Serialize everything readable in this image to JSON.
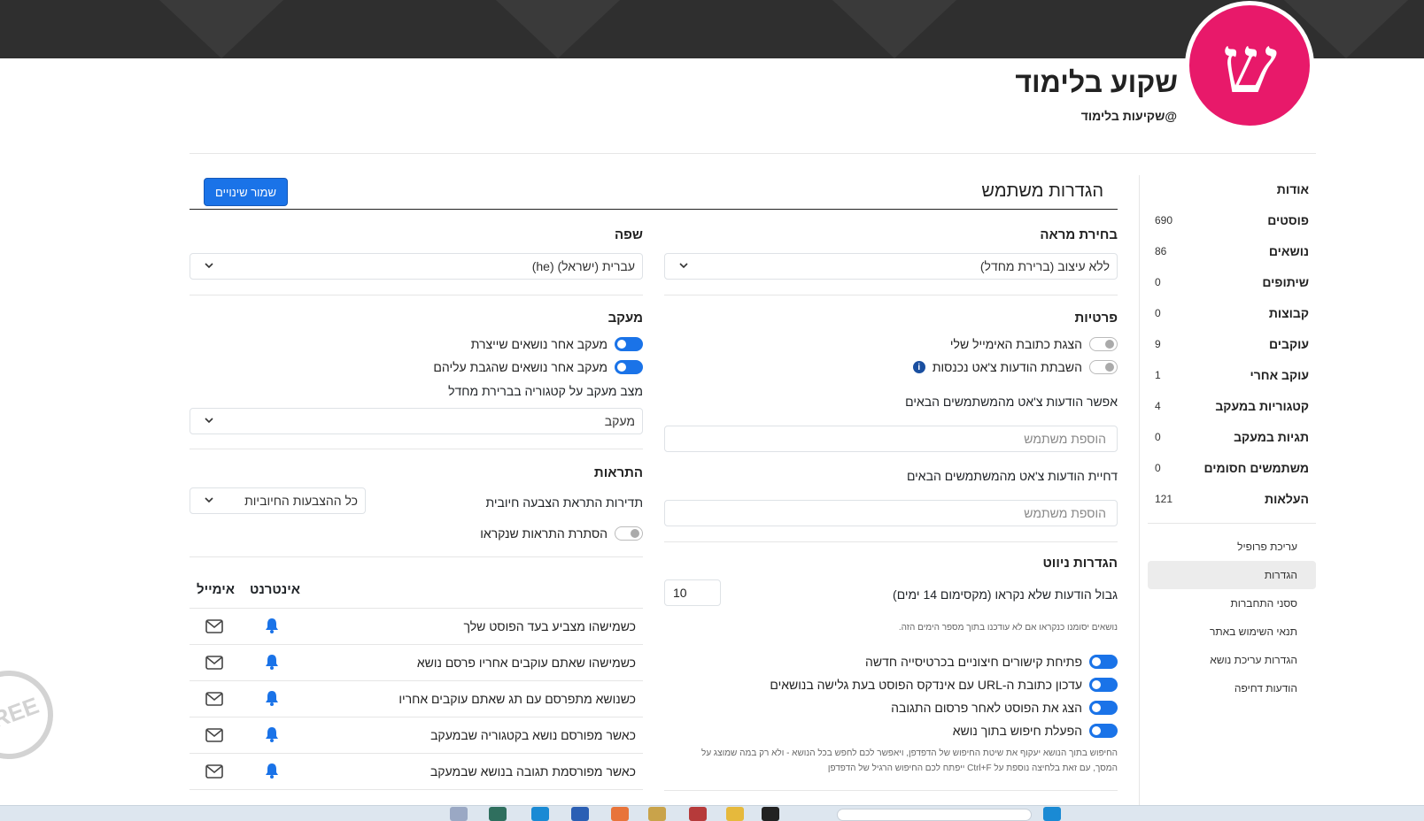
{
  "profile": {
    "initial": "ש",
    "name": "שקוע בלימוד",
    "handle": "@שקיעות בלימוד"
  },
  "sidebar": {
    "items": [
      {
        "label": "אודות",
        "count": ""
      },
      {
        "label": "פוסטים",
        "count": "690"
      },
      {
        "label": "נושאים",
        "count": "86"
      },
      {
        "label": "שיתופים",
        "count": "0"
      },
      {
        "label": "קבוצות",
        "count": "0"
      },
      {
        "label": "עוקבים",
        "count": "9"
      },
      {
        "label": "עוקב אחרי",
        "count": "1"
      },
      {
        "label": "קטגוריות במעקב",
        "count": "4"
      },
      {
        "label": "תגיות במעקב",
        "count": "0"
      },
      {
        "label": "משתמשים חסומים",
        "count": "0"
      },
      {
        "label": "העלאות",
        "count": "121"
      }
    ],
    "links": [
      "עריכת פרופיל",
      "הגדרות",
      "ססני התחברות",
      "תנאי השימוש באתר",
      "הגדרות עריכת נושא",
      "הודעות דחיפה"
    ],
    "active_link": "הגדרות"
  },
  "main": {
    "title": "הגדרות משתמש",
    "save_label": "שמור שינויים",
    "appearance": {
      "title": "בחירת מראה",
      "value": "ללא עיצוב (ברירת מחדל)"
    },
    "language": {
      "title": "שפה",
      "value": "עברית (ישראל) (he)"
    },
    "privacy": {
      "title": "פרטיות",
      "show_email": "הצגת כתובת האימייל שלי",
      "mute_chat": "השבתת הודעות צ'אט נכנסות",
      "allow_chat_label": "אפשר הודעות צ'אט מהמשתמשים הבאים",
      "allow_chat_placeholder": "הוספת משתמש",
      "deny_chat_label": "דחיית הודעות צ'אט מהמשתמשים הבאים",
      "deny_chat_placeholder": "הוספת משתמש"
    },
    "tracking": {
      "title": "מעקב",
      "follow_created": "מעקב אחר נושאים שייצרת",
      "follow_replied": "מעקב אחר נושאים שהגבת עליהם",
      "category_label": "מצב מעקב על קטגוריה בברירת מחדל",
      "category_value": "מעקב"
    },
    "notifications": {
      "title": "התראות",
      "upvote_freq_label": "תדירות התראת הצבעה חיובית",
      "upvote_freq_value": "כל ההצבעות החיוביות",
      "hide_read": "הסתרת התראות שנקראו",
      "col_web": "אינטרנט",
      "col_email": "אימייל",
      "rows": [
        "כשמישהו מצביע בעד הפוסט שלך",
        "כשמישהו שאתם עוקבים אחריו פרסם נושא",
        "כשנושא מתפרסם עם תג שאתם עוקבים אחריו",
        "כאשר מפורסם נושא בקטגוריה שבמעקב",
        "כאשר מפורסמת תגובה בנושא שבמעקב"
      ]
    },
    "navigation": {
      "title": "הגדרות ניווט",
      "max_unread_label": "גבול הודעות שלא נקראו (מקסימום 14 ימים)",
      "max_unread_value": "10",
      "max_unread_note": "נושאים יסומנו כנקראו אם לא עודכנו בתוך מספר הימים הזה.",
      "open_links_new_tab": "פתיחת קישורים חיצוניים בכרטיסייה חדשה",
      "update_url": "עדכון כתובת ה-URL עם אינדקס הפוסט בעת גלישה בנושאים",
      "show_post_after_reply": "הצג את הפוסט לאחר פרסום התגובה",
      "in_topic_search": "הפעלת חיפוש בתוך נושא",
      "search_note_1": "החיפוש בתוך הנושא יעקוף את שיטת החיפוש של הדפדפן, ויאפשר לכם לחפש בכל הנושא - ולא רק במה שמוצג על",
      "search_note_2": "המסך, עם זאת בלחיצה נוספת על Ctrl+F ייפתח לכם החיפוש הרגיל של הדפדפן"
    }
  },
  "watermark": "FREE"
}
